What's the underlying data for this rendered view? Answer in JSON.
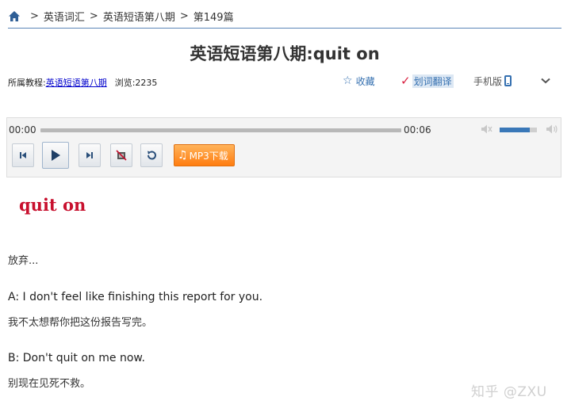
{
  "breadcrumb": {
    "home_icon": "home-icon",
    "separator": ">",
    "items": [
      "英语词汇",
      "英语短语第八期",
      "第149篇"
    ]
  },
  "page": {
    "title": "英语短语第八期:quit on"
  },
  "meta": {
    "tutorial_label": "所属教程:",
    "tutorial_link": "英语短语第八期",
    "views": "浏览:2235"
  },
  "toolbar": {
    "favorite": "收藏",
    "translate": "划词翻译",
    "mobile": "手机版",
    "more_icon": "chevron-down-icon"
  },
  "player": {
    "current_time": "00:00",
    "duration": "00:06",
    "progress_fraction": 0,
    "volume_fraction": 0.8,
    "mp3_label": "MP3下载",
    "icons": [
      "prev-icon",
      "play-icon",
      "next-icon",
      "stop-icon",
      "loop-icon",
      "mute-icon",
      "volume-max-icon"
    ]
  },
  "content": {
    "heading": "quit on",
    "meaning": "放弃...",
    "example_a_en": "A: I don't feel like finishing this report for you.",
    "example_a_zh": "我不太想帮你把这份报告写完。",
    "example_b_en": "B: Don't quit on me now.",
    "example_b_zh": "别现在见死不救。"
  },
  "watermark": "知乎 @ZXU",
  "colors": {
    "accent": "#3570b0",
    "heading_red": "#c8102e",
    "mp3_orange": "#ff8c1a"
  }
}
